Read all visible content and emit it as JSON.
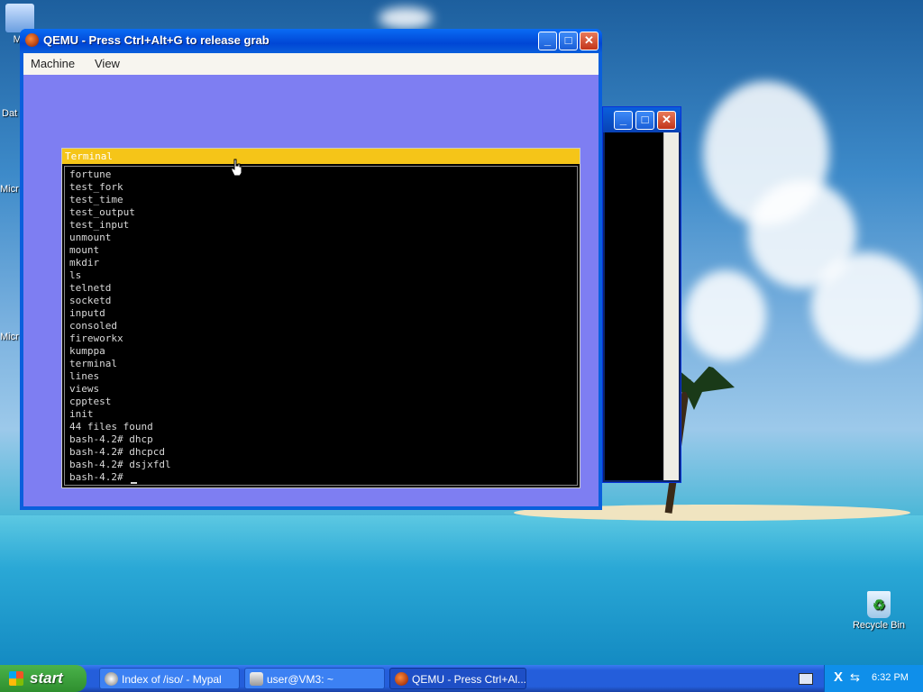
{
  "desktop": {
    "icons": [
      {
        "label": "My",
        "icon": "computer-icon"
      },
      {
        "label": "Dat",
        "icon": "folder-icon"
      },
      {
        "label": "Micr",
        "icon": "app-icon"
      },
      {
        "label": "Micr",
        "icon": "app-icon"
      },
      {
        "label": "Recycle Bin",
        "icon": "recycle-bin-icon"
      }
    ]
  },
  "qemu_window": {
    "title": "QEMU - Press Ctrl+Alt+G to release grab",
    "menu": [
      "Machine",
      "View"
    ],
    "buttons": {
      "minimize": "_",
      "maximize": "□",
      "close": "✕"
    }
  },
  "guest_terminal": {
    "title": "Terminal",
    "lines": [
      "fortune",
      "test_fork",
      "test_time",
      "test_output",
      "test_input",
      "unmount",
      "mount",
      "mkdir",
      "ls",
      "telnetd",
      "socketd",
      "inputd",
      "consoled",
      "fireworkx",
      "kumppa",
      "terminal",
      "lines",
      "views",
      "cpptest",
      "init",
      "44 files found",
      "bash-4.2# dhcp",
      "bash-4.2# dhcpcd",
      "bash-4.2# dsjxfdl",
      "bash-4.2# "
    ]
  },
  "taskbar": {
    "start_label": "start",
    "tasks": [
      {
        "label": "Index of /iso/ - Mypal",
        "icon": "browser-icon",
        "active": false
      },
      {
        "label": "user@VM3: ~",
        "icon": "terminal-icon",
        "active": false
      },
      {
        "label": "QEMU - Press Ctrl+Al...",
        "icon": "qemu-icon",
        "active": true
      }
    ],
    "clock": "6:32 PM"
  }
}
